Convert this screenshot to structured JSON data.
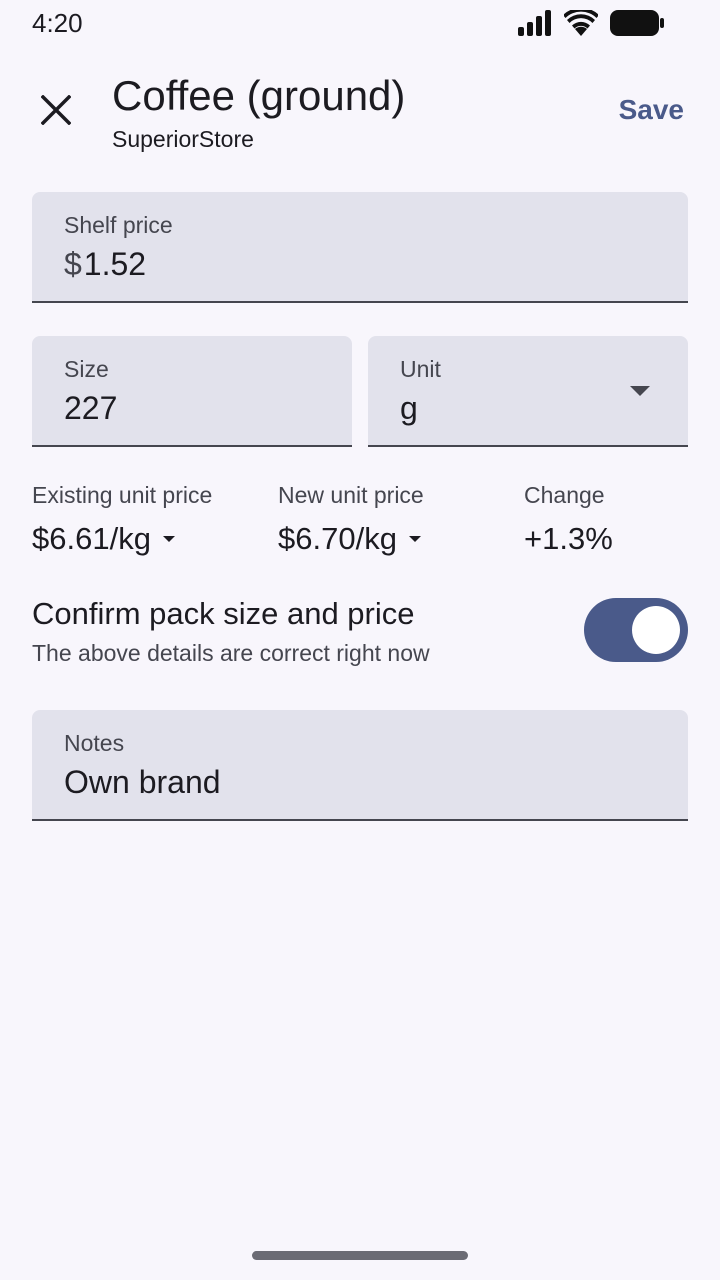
{
  "status_bar": {
    "time": "4:20",
    "icons": [
      "signal-icon",
      "wifi-icon",
      "battery-icon"
    ]
  },
  "app_bar": {
    "title": "Coffee (ground)",
    "subtitle": "SuperiorStore",
    "save_label": "Save",
    "close_icon": "close-icon"
  },
  "form": {
    "shelf_price": {
      "label": "Shelf price",
      "prefix": "$",
      "value": "1.52"
    },
    "size": {
      "label": "Size",
      "value": "227"
    },
    "unit": {
      "label": "Unit",
      "value": "g"
    }
  },
  "unit_prices": {
    "existing": {
      "label": "Existing unit price",
      "value": "$6.61/kg"
    },
    "new": {
      "label": "New unit price",
      "value": "$6.70/kg"
    },
    "change": {
      "label": "Change",
      "value": "+1.3%"
    }
  },
  "confirm": {
    "title": "Confirm pack size and price",
    "subtitle": "The above details are correct right now",
    "checked": true
  },
  "notes": {
    "label": "Notes",
    "value": "Own brand"
  },
  "colors": {
    "background": "#f8f6fc",
    "field": "#e2e2ec",
    "accent": "#4a5a8a",
    "text": "#1c1b21",
    "muted": "#45464f"
  }
}
